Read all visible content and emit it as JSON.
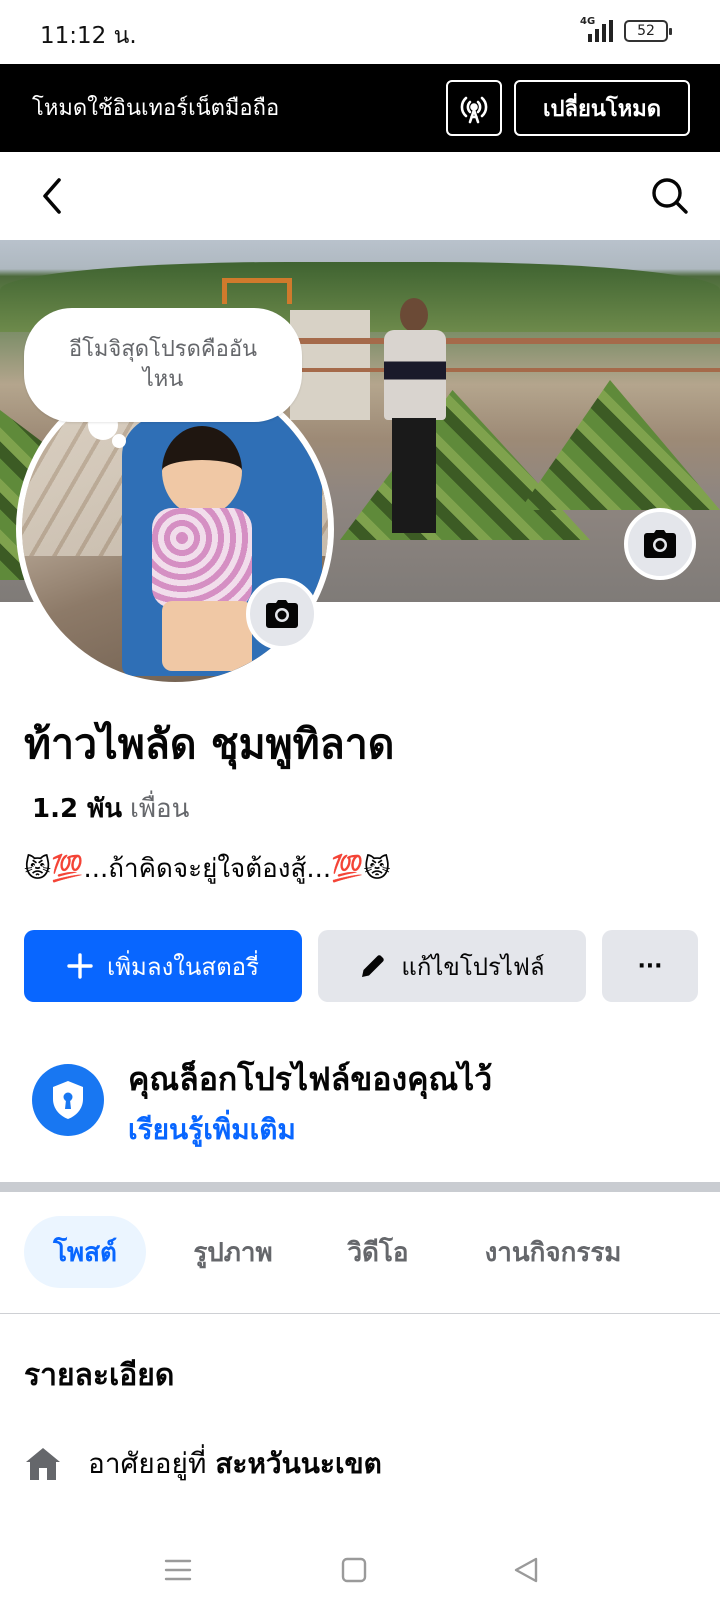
{
  "status_bar": {
    "time": "11:12 น.",
    "network": "4G",
    "battery": "52"
  },
  "mode_bar": {
    "text": "โหมดใช้อินเทอร์เน็ตมือถือ",
    "switch_label": "เปลี่ยนโหมด"
  },
  "bubble": {
    "text": "อีโมจิสุดโปรดคืออันไหน"
  },
  "profile": {
    "name": "ท้าวไพลัด ชุมพูทิลาด",
    "friends_count": "1.2 พัน",
    "friends_label": "เพื่อน",
    "bio": "😾💯...ถ้าคิดจะยู่ใจต้องสู้...💯😾"
  },
  "actions": {
    "story": "เพิ่มลงในสตอรี่",
    "edit": "แก้ไขโปรไฟล์",
    "more": "···"
  },
  "lock_notice": {
    "title": "คุณล็อกโปรไฟล์ของคุณไว้",
    "link": "เรียนรู้เพิ่มเติม"
  },
  "tabs": [
    {
      "label": "โพสต์",
      "active": true
    },
    {
      "label": "รูปภาพ",
      "active": false
    },
    {
      "label": "วิดีโอ",
      "active": false
    },
    {
      "label": "งานกิจกรรม",
      "active": false
    }
  ],
  "details": {
    "title": "รายละเอียด",
    "location_prefix": "อาศัยอยู่ที่",
    "location_value": "สะหวันนะเขต"
  },
  "colors": {
    "accent": "#0866ff",
    "lock_icon": "#1877f2",
    "tab_active_bg": "#ebf5ff"
  }
}
